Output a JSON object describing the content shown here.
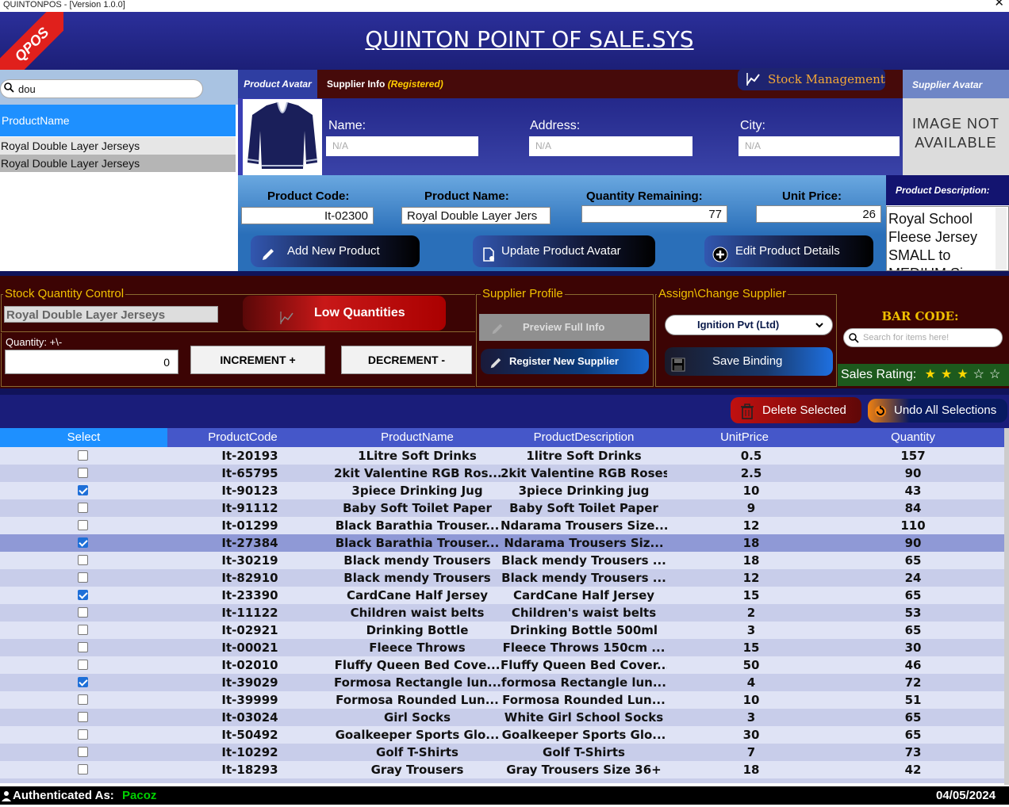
{
  "window": {
    "title": "QUINTONPOS - [Version 1.0.0]",
    "close": "✕"
  },
  "header": {
    "title": "QUINTON POINT OF SALE.SYS",
    "ribbon": "QPOS"
  },
  "search": {
    "value": "dou"
  },
  "product_list": {
    "header": "ProductName",
    "items": [
      "Royal Double Layer Jerseys",
      "Royal Double Layer Jerseys"
    ]
  },
  "supplier": {
    "product_avatar_label": "Product Avatar",
    "info_label": "Supplier Info",
    "status": "(Registered)",
    "stock_button": "Stock Management",
    "avatar_label": "Supplier Avatar",
    "image_na": "IMAGE NOT AVAILABLE",
    "name_label": "Name:",
    "name_value": "N/A",
    "address_label": "Address:",
    "address_value": "N/A",
    "city_label": "City:",
    "city_value": "N/A"
  },
  "product": {
    "code_label": "Product Code:",
    "code_value": "It-02300",
    "name_label": "Product Name:",
    "name_value": "Royal Double Layer Jers",
    "qty_label": "Quantity Remaining:",
    "qty_value": "77",
    "price_label": "Unit Price:",
    "price_value": "26",
    "desc_label": "Product Description:",
    "desc_value": "Royal School Fleese Jersey SMALL to MEDIUM Size",
    "add_button": "Add New Product",
    "update_avatar_button": "Update Product Avatar",
    "edit_button": "Edit Product Details"
  },
  "stock_control": {
    "title": "Stock Quantity Control",
    "product_value": "Royal Double Layer Jerseys",
    "low_button": "Low Quantities",
    "qty_label": "Quantity: +\\-",
    "qty_value": "0",
    "increment": "INCREMENT +",
    "decrement": "DECREMENT -"
  },
  "supplier_profile": {
    "title": "Supplier Profile",
    "preview_button": "Preview Full Info",
    "register_button": "Register New Supplier"
  },
  "assign": {
    "title": "Assign\\Change Supplier",
    "selected": "Ignition Pvt (Ltd)",
    "save_button": "Save Binding"
  },
  "barcode": {
    "label": "BAR CODE:",
    "placeholder": "Search for items here!"
  },
  "rating": {
    "label": "Sales Rating:",
    "stars_filled": 3,
    "stars_total": 5,
    "star_filled_color": "#ffd700"
  },
  "actions": {
    "delete": "Delete Selected",
    "undo": "Undo All Selections"
  },
  "grid": {
    "columns": [
      "Select",
      "ProductCode",
      "ProductName",
      "ProductDescription",
      "UnitPrice",
      "Quantity"
    ],
    "rows": [
      {
        "checked": false,
        "code": "It-20193",
        "name": "1Litre Soft Drinks",
        "desc": "1litre Soft Drinks",
        "price": "0.5",
        "qty": "157"
      },
      {
        "checked": false,
        "code": "It-65795",
        "name": "2kit Valentine RGB Ros...",
        "desc": "2kit Valentine RGB Roses",
        "price": "2.5",
        "qty": "90"
      },
      {
        "checked": true,
        "code": "It-90123",
        "name": "3piece Drinking Jug",
        "desc": "3piece Drinking jug",
        "price": "10",
        "qty": "43"
      },
      {
        "checked": false,
        "code": "It-91112",
        "name": "Baby Soft Toilet Paper",
        "desc": "Baby Soft Toilet Paper",
        "price": "9",
        "qty": "84"
      },
      {
        "checked": false,
        "code": "It-01299",
        "name": "Black Barathia Trouser...",
        "desc": "Ndarama Trousers Size...",
        "price": "12",
        "qty": "110"
      },
      {
        "checked": true,
        "code": "It-27384",
        "name": "Black Barathia Trouser...",
        "desc": "Ndarama Trousers  Siz...",
        "price": "18",
        "qty": "90",
        "highlight": true
      },
      {
        "checked": false,
        "code": "It-30219",
        "name": "Black mendy Trousers",
        "desc": "Black mendy Trousers ...",
        "price": "18",
        "qty": "65"
      },
      {
        "checked": false,
        "code": "It-82910",
        "name": "Black mendy Trousers",
        "desc": "Black mendy Trousers ...",
        "price": "12",
        "qty": "24"
      },
      {
        "checked": true,
        "code": "It-23390",
        "name": "CardCane Half Jersey",
        "desc": "CardCane Half Jersey",
        "price": "15",
        "qty": "65"
      },
      {
        "checked": false,
        "code": "It-11122",
        "name": "Children waist belts",
        "desc": "Children's waist belts",
        "price": "2",
        "qty": "53"
      },
      {
        "checked": false,
        "code": "It-02921",
        "name": "Drinking Bottle",
        "desc": "Drinking Bottle 500ml",
        "price": "3",
        "qty": "65"
      },
      {
        "checked": false,
        "code": "It-00021",
        "name": "Fleece Throws",
        "desc": "Fleece Throws 150cm ...",
        "price": "15",
        "qty": "30"
      },
      {
        "checked": false,
        "code": "It-02010",
        "name": "Fluffy Queen Bed Cove...",
        "desc": "Fluffy Queen Bed Cover...",
        "price": "50",
        "qty": "46"
      },
      {
        "checked": true,
        "code": "It-39029",
        "name": "Formosa Rectangle lun...",
        "desc": "formosa Rectangle lun...",
        "price": "4",
        "qty": "72"
      },
      {
        "checked": false,
        "code": "It-39999",
        "name": "Formosa Rounded Lun...",
        "desc": "Formosa Rounded Lun...",
        "price": "10",
        "qty": "51"
      },
      {
        "checked": false,
        "code": "It-03024",
        "name": "Girl Socks",
        "desc": "White Girl School Socks",
        "price": "3",
        "qty": "65"
      },
      {
        "checked": false,
        "code": "It-50492",
        "name": "Goalkeeper Sports Glo...",
        "desc": "Goalkeeper Sports Glo...",
        "price": "30",
        "qty": "65"
      },
      {
        "checked": false,
        "code": "It-10292",
        "name": "Golf T-Shirts",
        "desc": "Golf T-Shirts",
        "price": "7",
        "qty": "73"
      },
      {
        "checked": false,
        "code": "It-18293",
        "name": "Gray Trousers",
        "desc": "Gray Trousers  Size 36+",
        "price": "18",
        "qty": "42"
      }
    ]
  },
  "status": {
    "auth_label": "Authenticated As:",
    "user": "Pacoz",
    "date": "04/05/2024"
  },
  "colors": {
    "accent_green": "#00d000",
    "row_light": "#dfe3f5",
    "row_alt": "#c8cdea",
    "row_highlight": "#8f99d6"
  }
}
